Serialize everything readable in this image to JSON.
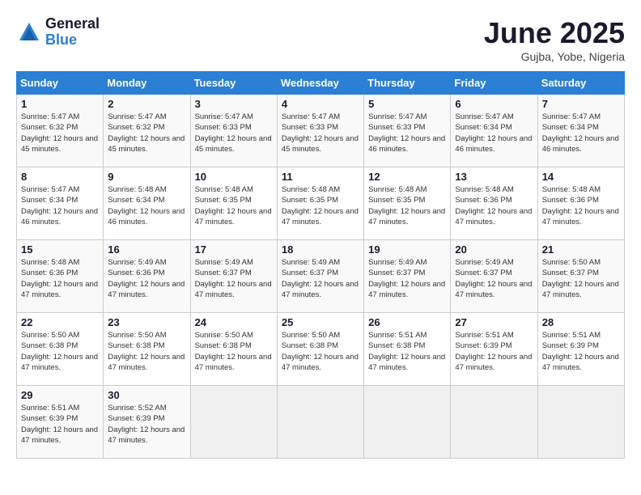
{
  "logo": {
    "general": "General",
    "blue": "Blue"
  },
  "title": "June 2025",
  "location": "Gujba, Yobe, Nigeria",
  "weekdays": [
    "Sunday",
    "Monday",
    "Tuesday",
    "Wednesday",
    "Thursday",
    "Friday",
    "Saturday"
  ],
  "weeks": [
    [
      {
        "day": "1",
        "sunrise": "5:47 AM",
        "sunset": "6:32 PM",
        "daylight": "12 hours and 45 minutes."
      },
      {
        "day": "2",
        "sunrise": "5:47 AM",
        "sunset": "6:32 PM",
        "daylight": "12 hours and 45 minutes."
      },
      {
        "day": "3",
        "sunrise": "5:47 AM",
        "sunset": "6:33 PM",
        "daylight": "12 hours and 45 minutes."
      },
      {
        "day": "4",
        "sunrise": "5:47 AM",
        "sunset": "6:33 PM",
        "daylight": "12 hours and 45 minutes."
      },
      {
        "day": "5",
        "sunrise": "5:47 AM",
        "sunset": "6:33 PM",
        "daylight": "12 hours and 46 minutes."
      },
      {
        "day": "6",
        "sunrise": "5:47 AM",
        "sunset": "6:34 PM",
        "daylight": "12 hours and 46 minutes."
      },
      {
        "day": "7",
        "sunrise": "5:47 AM",
        "sunset": "6:34 PM",
        "daylight": "12 hours and 46 minutes."
      }
    ],
    [
      {
        "day": "8",
        "sunrise": "5:47 AM",
        "sunset": "6:34 PM",
        "daylight": "12 hours and 46 minutes."
      },
      {
        "day": "9",
        "sunrise": "5:48 AM",
        "sunset": "6:34 PM",
        "daylight": "12 hours and 46 minutes."
      },
      {
        "day": "10",
        "sunrise": "5:48 AM",
        "sunset": "6:35 PM",
        "daylight": "12 hours and 47 minutes."
      },
      {
        "day": "11",
        "sunrise": "5:48 AM",
        "sunset": "6:35 PM",
        "daylight": "12 hours and 47 minutes."
      },
      {
        "day": "12",
        "sunrise": "5:48 AM",
        "sunset": "6:35 PM",
        "daylight": "12 hours and 47 minutes."
      },
      {
        "day": "13",
        "sunrise": "5:48 AM",
        "sunset": "6:36 PM",
        "daylight": "12 hours and 47 minutes."
      },
      {
        "day": "14",
        "sunrise": "5:48 AM",
        "sunset": "6:36 PM",
        "daylight": "12 hours and 47 minutes."
      }
    ],
    [
      {
        "day": "15",
        "sunrise": "5:48 AM",
        "sunset": "6:36 PM",
        "daylight": "12 hours and 47 minutes."
      },
      {
        "day": "16",
        "sunrise": "5:49 AM",
        "sunset": "6:36 PM",
        "daylight": "12 hours and 47 minutes."
      },
      {
        "day": "17",
        "sunrise": "5:49 AM",
        "sunset": "6:37 PM",
        "daylight": "12 hours and 47 minutes."
      },
      {
        "day": "18",
        "sunrise": "5:49 AM",
        "sunset": "6:37 PM",
        "daylight": "12 hours and 47 minutes."
      },
      {
        "day": "19",
        "sunrise": "5:49 AM",
        "sunset": "6:37 PM",
        "daylight": "12 hours and 47 minutes."
      },
      {
        "day": "20",
        "sunrise": "5:49 AM",
        "sunset": "6:37 PM",
        "daylight": "12 hours and 47 minutes."
      },
      {
        "day": "21",
        "sunrise": "5:50 AM",
        "sunset": "6:37 PM",
        "daylight": "12 hours and 47 minutes."
      }
    ],
    [
      {
        "day": "22",
        "sunrise": "5:50 AM",
        "sunset": "6:38 PM",
        "daylight": "12 hours and 47 minutes."
      },
      {
        "day": "23",
        "sunrise": "5:50 AM",
        "sunset": "6:38 PM",
        "daylight": "12 hours and 47 minutes."
      },
      {
        "day": "24",
        "sunrise": "5:50 AM",
        "sunset": "6:38 PM",
        "daylight": "12 hours and 47 minutes."
      },
      {
        "day": "25",
        "sunrise": "5:50 AM",
        "sunset": "6:38 PM",
        "daylight": "12 hours and 47 minutes."
      },
      {
        "day": "26",
        "sunrise": "5:51 AM",
        "sunset": "6:38 PM",
        "daylight": "12 hours and 47 minutes."
      },
      {
        "day": "27",
        "sunrise": "5:51 AM",
        "sunset": "6:39 PM",
        "daylight": "12 hours and 47 minutes."
      },
      {
        "day": "28",
        "sunrise": "5:51 AM",
        "sunset": "6:39 PM",
        "daylight": "12 hours and 47 minutes."
      }
    ],
    [
      {
        "day": "29",
        "sunrise": "5:51 AM",
        "sunset": "6:39 PM",
        "daylight": "12 hours and 47 minutes."
      },
      {
        "day": "30",
        "sunrise": "5:52 AM",
        "sunset": "6:39 PM",
        "daylight": "12 hours and 47 minutes."
      },
      null,
      null,
      null,
      null,
      null
    ]
  ]
}
